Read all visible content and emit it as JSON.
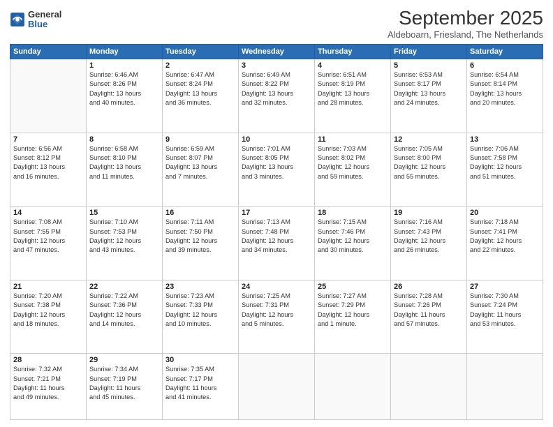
{
  "header": {
    "logo": {
      "general": "General",
      "blue": "Blue"
    },
    "title": "September 2025",
    "location": "Aldeboarn, Friesland, The Netherlands"
  },
  "columns": [
    "Sunday",
    "Monday",
    "Tuesday",
    "Wednesday",
    "Thursday",
    "Friday",
    "Saturday"
  ],
  "weeks": [
    [
      {
        "day": "",
        "info": ""
      },
      {
        "day": "1",
        "info": "Sunrise: 6:46 AM\nSunset: 8:26 PM\nDaylight: 13 hours\nand 40 minutes."
      },
      {
        "day": "2",
        "info": "Sunrise: 6:47 AM\nSunset: 8:24 PM\nDaylight: 13 hours\nand 36 minutes."
      },
      {
        "day": "3",
        "info": "Sunrise: 6:49 AM\nSunset: 8:22 PM\nDaylight: 13 hours\nand 32 minutes."
      },
      {
        "day": "4",
        "info": "Sunrise: 6:51 AM\nSunset: 8:19 PM\nDaylight: 13 hours\nand 28 minutes."
      },
      {
        "day": "5",
        "info": "Sunrise: 6:53 AM\nSunset: 8:17 PM\nDaylight: 13 hours\nand 24 minutes."
      },
      {
        "day": "6",
        "info": "Sunrise: 6:54 AM\nSunset: 8:14 PM\nDaylight: 13 hours\nand 20 minutes."
      }
    ],
    [
      {
        "day": "7",
        "info": "Sunrise: 6:56 AM\nSunset: 8:12 PM\nDaylight: 13 hours\nand 16 minutes."
      },
      {
        "day": "8",
        "info": "Sunrise: 6:58 AM\nSunset: 8:10 PM\nDaylight: 13 hours\nand 11 minutes."
      },
      {
        "day": "9",
        "info": "Sunrise: 6:59 AM\nSunset: 8:07 PM\nDaylight: 13 hours\nand 7 minutes."
      },
      {
        "day": "10",
        "info": "Sunrise: 7:01 AM\nSunset: 8:05 PM\nDaylight: 13 hours\nand 3 minutes."
      },
      {
        "day": "11",
        "info": "Sunrise: 7:03 AM\nSunset: 8:02 PM\nDaylight: 12 hours\nand 59 minutes."
      },
      {
        "day": "12",
        "info": "Sunrise: 7:05 AM\nSunset: 8:00 PM\nDaylight: 12 hours\nand 55 minutes."
      },
      {
        "day": "13",
        "info": "Sunrise: 7:06 AM\nSunset: 7:58 PM\nDaylight: 12 hours\nand 51 minutes."
      }
    ],
    [
      {
        "day": "14",
        "info": "Sunrise: 7:08 AM\nSunset: 7:55 PM\nDaylight: 12 hours\nand 47 minutes."
      },
      {
        "day": "15",
        "info": "Sunrise: 7:10 AM\nSunset: 7:53 PM\nDaylight: 12 hours\nand 43 minutes."
      },
      {
        "day": "16",
        "info": "Sunrise: 7:11 AM\nSunset: 7:50 PM\nDaylight: 12 hours\nand 39 minutes."
      },
      {
        "day": "17",
        "info": "Sunrise: 7:13 AM\nSunset: 7:48 PM\nDaylight: 12 hours\nand 34 minutes."
      },
      {
        "day": "18",
        "info": "Sunrise: 7:15 AM\nSunset: 7:46 PM\nDaylight: 12 hours\nand 30 minutes."
      },
      {
        "day": "19",
        "info": "Sunrise: 7:16 AM\nSunset: 7:43 PM\nDaylight: 12 hours\nand 26 minutes."
      },
      {
        "day": "20",
        "info": "Sunrise: 7:18 AM\nSunset: 7:41 PM\nDaylight: 12 hours\nand 22 minutes."
      }
    ],
    [
      {
        "day": "21",
        "info": "Sunrise: 7:20 AM\nSunset: 7:38 PM\nDaylight: 12 hours\nand 18 minutes."
      },
      {
        "day": "22",
        "info": "Sunrise: 7:22 AM\nSunset: 7:36 PM\nDaylight: 12 hours\nand 14 minutes."
      },
      {
        "day": "23",
        "info": "Sunrise: 7:23 AM\nSunset: 7:33 PM\nDaylight: 12 hours\nand 10 minutes."
      },
      {
        "day": "24",
        "info": "Sunrise: 7:25 AM\nSunset: 7:31 PM\nDaylight: 12 hours\nand 5 minutes."
      },
      {
        "day": "25",
        "info": "Sunrise: 7:27 AM\nSunset: 7:29 PM\nDaylight: 12 hours\nand 1 minute."
      },
      {
        "day": "26",
        "info": "Sunrise: 7:28 AM\nSunset: 7:26 PM\nDaylight: 11 hours\nand 57 minutes."
      },
      {
        "day": "27",
        "info": "Sunrise: 7:30 AM\nSunset: 7:24 PM\nDaylight: 11 hours\nand 53 minutes."
      }
    ],
    [
      {
        "day": "28",
        "info": "Sunrise: 7:32 AM\nSunset: 7:21 PM\nDaylight: 11 hours\nand 49 minutes."
      },
      {
        "day": "29",
        "info": "Sunrise: 7:34 AM\nSunset: 7:19 PM\nDaylight: 11 hours\nand 45 minutes."
      },
      {
        "day": "30",
        "info": "Sunrise: 7:35 AM\nSunset: 7:17 PM\nDaylight: 11 hours\nand 41 minutes."
      },
      {
        "day": "",
        "info": ""
      },
      {
        "day": "",
        "info": ""
      },
      {
        "day": "",
        "info": ""
      },
      {
        "day": "",
        "info": ""
      }
    ]
  ]
}
